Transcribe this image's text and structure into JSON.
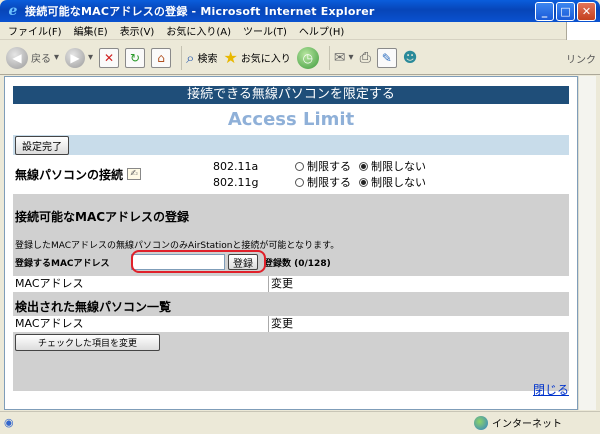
{
  "window": {
    "title": "接続可能なMACアドレスの登録 - Microsoft Internet Explorer"
  },
  "menu": [
    "ファイル(F)",
    "編集(E)",
    "表示(V)",
    "お気に入り(A)",
    "ツール(T)",
    "ヘルプ(H)"
  ],
  "toolbar": {
    "back_label": "戻る",
    "search_label": "検索",
    "favorites_label": "お気に入り",
    "links_label": "リンク"
  },
  "page": {
    "banner": "接続できる無線パソコンを限定する",
    "title": "Access Limit",
    "settings_done": "設定完了",
    "wireless_label": "無線パソコンの接続",
    "bands": [
      {
        "name": "802.11a",
        "opt1": "制限する",
        "opt2": "制限しない",
        "selected": "制限しない"
      },
      {
        "name": "802.11g",
        "opt1": "制限する",
        "opt2": "制限しない",
        "selected": "制限しない"
      }
    ],
    "register_title": "接続可能なMACアドレスの登録",
    "note": "登録したMACアドレスの無線パソコンのみAirStationと接続が可能となります。",
    "mac_register_label": "登録するMACアドレス",
    "mac_input_value": "",
    "register_button": "登録",
    "count_label": "登録数 (0/128)",
    "table1": {
      "col1": "MACアドレス",
      "col2": "変更"
    },
    "detected_title": "検出された無線パソコン一覧",
    "table2": {
      "col1": "MACアドレス",
      "col2": "変更"
    },
    "change_checked_button": "チェックした項目を変更",
    "close_link": "閉じる"
  },
  "status": {
    "zone": "インターネット"
  }
}
